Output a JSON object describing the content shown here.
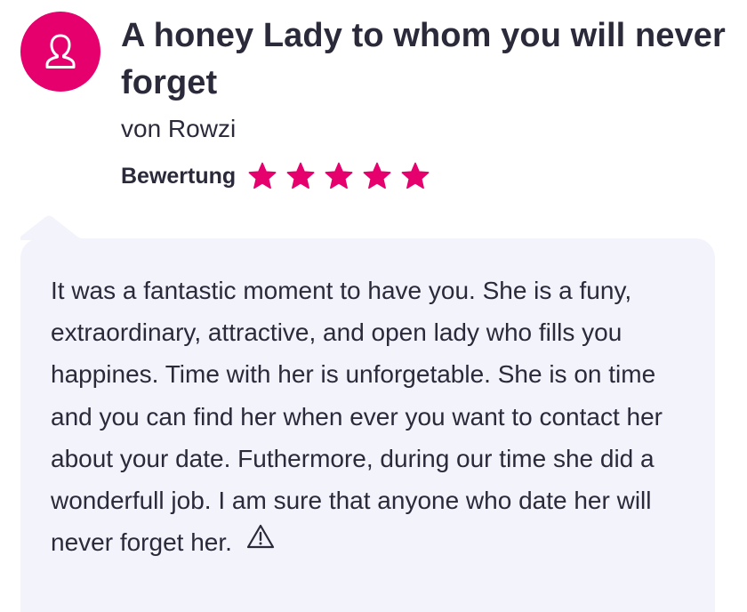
{
  "review": {
    "title": "A honey Lady to whom you will never forget",
    "author": "von Rowzi",
    "rating_label": "Bewertung",
    "rating_value": 5,
    "rating_max": 5,
    "text": "It was a fantastic moment to have you. She is a funy, extraordinary, attractive, and open lady who fills you happines. Time with her is unforgetable. She is on time and you can find her when ever you want to contact her about your date. Futhermore, during our time she did a wonderfull job. I am sure that anyone who date her will never forget her."
  },
  "icons": {
    "avatar": "user-icon",
    "rating": "star-icon",
    "report": "warning-icon"
  },
  "colors": {
    "accent": "#e6006e",
    "text": "#2a2a3a",
    "bubble": "#f3f3fb"
  }
}
